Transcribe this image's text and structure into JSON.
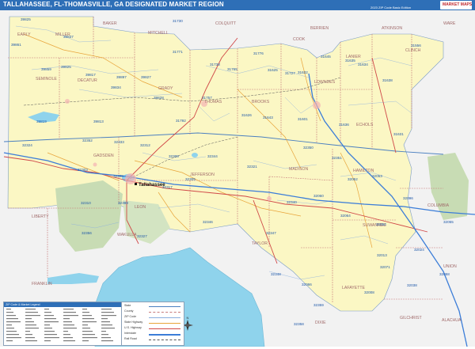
{
  "header": {
    "title": "TALLAHASSEE, FL-THOMASVILLE, GA DESIGNATED MARKET REGION",
    "edition": "2023 ZIP Code Basic Edition",
    "logo_text": "MARKET MAPS"
  },
  "colors": {
    "title_bar": "#2e6fb7",
    "region_fill": "#fbf7c4",
    "outside_fill": "#f2f2f2",
    "water": "#8fd3ec",
    "forest": "#c8dcb4",
    "county_line": "#c77b7b",
    "zip_line": "#6e96c8",
    "zip_label": "#1d57a8",
    "county_label": "#a06a6a",
    "interstate": "#3b7dd8",
    "us_highway": "#d04848",
    "state_highway": "#e8a43a"
  },
  "cities": [
    {
      "name": "Tallahassee"
    }
  ],
  "counties": [
    "BAKER",
    "COLQUITT",
    "MITCHELL",
    "BERRIEN",
    "ATKINSON",
    "WARE",
    "EARLY",
    "MILLER",
    "COOK",
    "LANIER",
    "CLINCH",
    "SEMINOLE",
    "DECATUR",
    "GRADY",
    "THOMAS",
    "BROOKS",
    "LOWNDES",
    "ECHOLS",
    "GADSDEN",
    "JEFFERSON",
    "MADISON",
    "HAMILTON",
    "LEON",
    "COLUMBIA",
    "LIBERTY",
    "WAKULLA",
    "TAYLOR",
    "SUWANNEE",
    "FRANKLIN",
    "LAFAYETTE",
    "GILCHRIST",
    "ALACHUA",
    "DIXIE",
    "UNION"
  ],
  "zip_codes": [
    "39825",
    "39837",
    "39861",
    "39859",
    "39825",
    "39817",
    "39897",
    "39827",
    "39828",
    "39834",
    "39819",
    "39813",
    "31730",
    "31771",
    "31776",
    "31738",
    "31765",
    "31625",
    "31727",
    "31632",
    "31645",
    "31635",
    "31634",
    "31556",
    "31638",
    "31757",
    "31626",
    "31643",
    "31792",
    "31601",
    "31636",
    "31631",
    "32324",
    "32352",
    "32333",
    "32312",
    "32309",
    "32344",
    "32321",
    "32350",
    "32351",
    "32303",
    "32308",
    "32317",
    "32305",
    "32310",
    "32399",
    "32327",
    "32346",
    "32347",
    "32340",
    "32060",
    "32052",
    "32053",
    "32096",
    "32064",
    "32054",
    "32013",
    "32071",
    "32356",
    "32348",
    "32066",
    "32359",
    "32008",
    "32024",
    "32038",
    "32055",
    "32058",
    "32358"
  ],
  "legend_title": "ZIP Code & Market Legend",
  "key_items": [
    "State",
    "County",
    "ZIP Code",
    "State Highway",
    "U.S. Highway",
    "Interstate",
    "Rail Road"
  ],
  "compass": "N"
}
